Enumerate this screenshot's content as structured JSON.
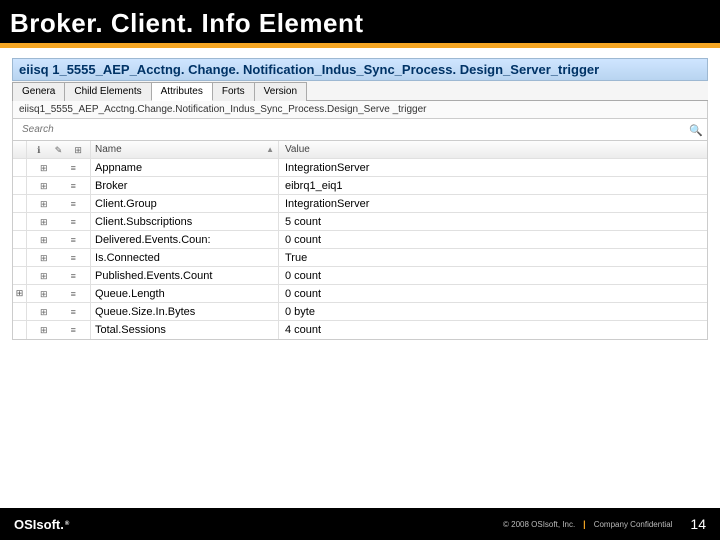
{
  "slide": {
    "title": "Broker. Client. Info Element",
    "brand": "OSIsoft.",
    "copyright": "© 2008 OSIsoft, Inc.",
    "confidential": "Company Confidential",
    "page": "14"
  },
  "panel": {
    "title": "eiisq 1_5555_AEP_Acctng. Change. Notification_Indus_Sync_Process. Design_Server_trigger",
    "path": "eiisq1_5555_AEP_Acctng.Change.Notification_Indus_Sync_Process.Design_Serve _trigger"
  },
  "tabs": [
    {
      "label": "Genera"
    },
    {
      "label": "Child Elements"
    },
    {
      "label": "Attributes"
    },
    {
      "label": "Forts"
    },
    {
      "label": "Version"
    }
  ],
  "search": {
    "placeholder": "Search"
  },
  "headers": {
    "name": "Name",
    "value": "Value"
  },
  "rows": [
    {
      "name": "Appname",
      "value": "IntegrationServer"
    },
    {
      "name": "Broker",
      "value": "eibrq1_eiq1"
    },
    {
      "name": "Client.Group",
      "value": "IntegrationServer"
    },
    {
      "name": "Client.Subscriptions",
      "value": "5 count"
    },
    {
      "name": "Delivered.Events.Coun:",
      "value": "0 count"
    },
    {
      "name": "Is.Connected",
      "value": "True"
    },
    {
      "name": "Published.Events.Count",
      "value": "0 count"
    },
    {
      "name": "Queue.Length",
      "value": "0 count"
    },
    {
      "name": "Queue.Size.In.Bytes",
      "value": "0 byte"
    },
    {
      "name": "Total.Sessions",
      "value": "4 count"
    }
  ]
}
